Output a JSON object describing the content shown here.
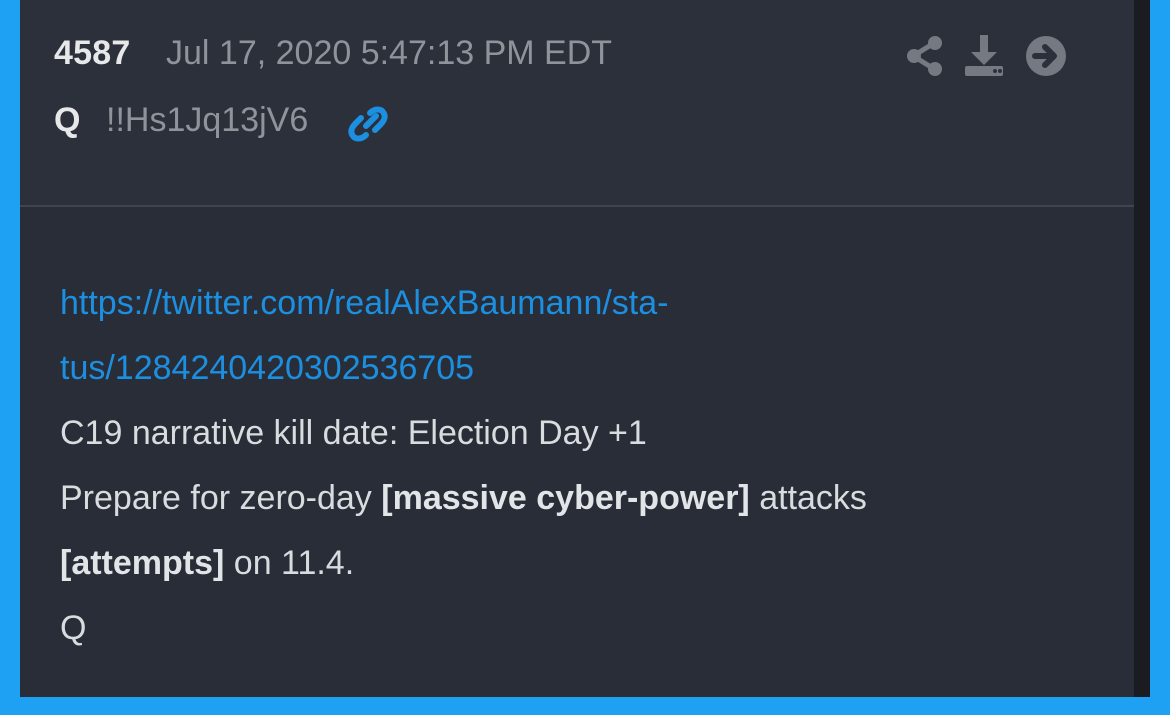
{
  "post": {
    "number": "4587",
    "timestamp": "Jul 17, 2020 5:47:13 PM EDT",
    "author": "Q",
    "tripcode": "!!Hs1Jq13jV6"
  },
  "icons": {
    "link": "link-icon",
    "share": "share-icon",
    "download": "download-icon",
    "goto": "arrow-right-circle-icon"
  },
  "content": {
    "url_line1": "https://twitter.com/realAlexBaumann/sta-",
    "url_line2": "tus/1284240420302536705",
    "line3": "C19 narrative kill date: Election Day +1",
    "line4_prefix": "Prepare for zero-day ",
    "line4_bold": "[massive cyber-power]",
    "line4_suffix": " attacks",
    "line5_bold": "[attempts]",
    "line5_suffix": " on 11.4.",
    "signature": "Q"
  },
  "colors": {
    "frame": "#1ea1f2",
    "card_header": "#2b303b",
    "card_body": "#282d37",
    "link": "#1d8fe0",
    "muted_text": "#8f949b",
    "text": "#d9dcdf"
  }
}
